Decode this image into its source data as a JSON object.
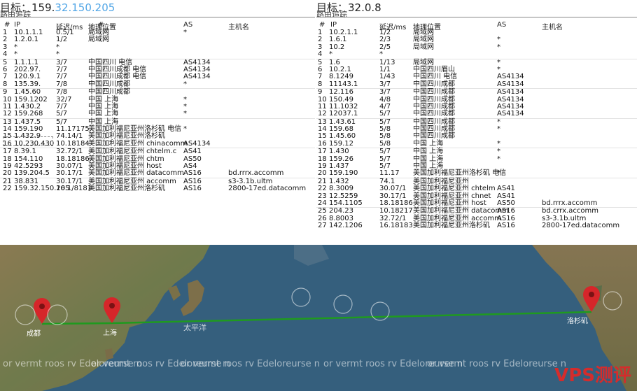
{
  "left": {
    "title_prefix": "目标：159.",
    "title_ip": "32.150.205",
    "subtitle": "路由追踪",
    "headers": [
      "#",
      "IP",
      "延迟/ms",
      "地理位置",
      "#",
      "AS",
      "主机名"
    ],
    "rows": [
      [
        "1",
        "10.1.1.1",
        "0.5/1",
        "局域网",
        "",
        "*",
        ""
      ],
      [
        "2",
        "1.2.0.1",
        "1/2",
        "局域网",
        "",
        "",
        ""
      ],
      [
        "3",
        "*",
        "*",
        "",
        "",
        "",
        ""
      ],
      [
        "4",
        "*",
        "*",
        "",
        "",
        "",
        ""
      ],
      [
        "5",
        "1.1.1.1",
        "3/7",
        "中国四川 电信",
        "",
        "AS4134",
        ""
      ],
      [
        "6",
        "202.97.",
        "7/7",
        "中国四川成都 电信",
        "",
        "AS4134",
        ""
      ],
      [
        "7",
        "120.9.1",
        "7/7",
        "中国四川成都 电信",
        "",
        "AS4134",
        ""
      ],
      [
        "8",
        "135.39.",
        "7/8",
        "中国四川成都",
        "",
        "*",
        ""
      ],
      [
        "9",
        "1.45.60",
        "7/8",
        "中国四川成都",
        "",
        "",
        ""
      ],
      [
        "10",
        "159.1202",
        "32/7",
        "中国 上海",
        "",
        "*",
        ""
      ],
      [
        "11",
        "1.430.2",
        "7/7",
        "中国 上海",
        "",
        "*",
        ""
      ],
      [
        "12",
        "159.268",
        "5/7",
        "中国 上海",
        "",
        "*",
        ""
      ],
      [
        "13",
        "1.437.5",
        "5/7",
        "中国 上海",
        "",
        "",
        ""
      ],
      [
        "14",
        "159.190",
        "11.17175",
        "美国加利福尼亚州洛杉矶 电信",
        "",
        "*",
        ""
      ],
      [
        "15",
        "1.432.9",
        "74.14/1",
        "美国加利福尼亚州洛杉矶",
        "",
        "",
        ""
      ],
      [
        "16",
        "10.230.430",
        "10.18184",
        "美国加利福尼亚州 chinacomm",
        "",
        "AS4134",
        ""
      ],
      [
        "17",
        "8.39.1",
        "32.72/1",
        "美国加利福尼亚州 chtelm.c",
        "",
        "AS41",
        ""
      ],
      [
        "18",
        "154.110",
        "18.18186",
        "美国加利福尼亚州 chtm",
        "",
        "AS50",
        ""
      ],
      [
        "19",
        "42.5293",
        "30.07/1",
        "美国加利福尼亚州 host",
        "",
        "AS4",
        ""
      ],
      [
        "20",
        "139.204.5",
        "30.17/1",
        "美国加利福尼亚州 datacomm",
        "",
        "AS16",
        "bd.rrrx.accomm"
      ],
      [
        "21",
        "38.831",
        "30.17/1",
        "美国加利福尼亚州 accomm",
        "",
        "AS16",
        "s3-3.1b.ultm"
      ],
      [
        "22",
        "159.32.150.205",
        "16.1/8181",
        "美国加利福尼亚州洛杉矶",
        "",
        "AS16",
        "2800-17ed.datacomm"
      ]
    ]
  },
  "right": {
    "title": "目标：32.0.8",
    "subtitle": "路由追踪",
    "headers": [
      "#",
      "IP",
      "延迟/ms",
      "地理位置",
      "AS",
      "主机名"
    ],
    "rows": [
      [
        "1",
        "10.2.1.1",
        "1/2",
        "局域网",
        "",
        ""
      ],
      [
        "2",
        "1.6.1",
        "2/3",
        "局域网",
        "*",
        ""
      ],
      [
        "3",
        "10.2",
        "2/5",
        "局域网",
        "*",
        ""
      ],
      [
        "4",
        "*",
        "*",
        "",
        "",
        ""
      ],
      [
        "5",
        "1.6",
        "1/13",
        "局域网",
        "*",
        ""
      ],
      [
        "6",
        "10.2.1",
        "1/1",
        "中国四川眉山",
        "*",
        ""
      ],
      [
        "7",
        "8.1249",
        "1/43",
        "中国四川 电信",
        "AS4134",
        ""
      ],
      [
        "8",
        "11143.1",
        "3/7",
        "中国四川成都",
        "AS4134",
        ""
      ],
      [
        "9",
        "12.116",
        "3/7",
        "中国四川成都",
        "AS4134",
        ""
      ],
      [
        "10",
        "150.49",
        "4/8",
        "中国四川成都",
        "AS4134",
        ""
      ],
      [
        "11",
        "11.1032",
        "4/7",
        "中国四川成都",
        "AS4134",
        ""
      ],
      [
        "12",
        "12037.1",
        "5/7",
        "中国四川成都",
        "AS4134",
        ""
      ],
      [
        "13",
        "1.43.61",
        "5/7",
        "中国四川成都",
        "*",
        ""
      ],
      [
        "14",
        "159.68",
        "5/8",
        "中国四川成都",
        "*",
        ""
      ],
      [
        "15",
        "1.45.60",
        "5/8",
        "中国四川成都",
        "",
        ""
      ],
      [
        "16",
        "159.12",
        "5/8",
        "中国 上海",
        "*",
        ""
      ],
      [
        "17",
        "1.430",
        "5/7",
        "中国 上海",
        "*",
        ""
      ],
      [
        "18",
        "159.26",
        "5/7",
        "中国 上海",
        "*",
        ""
      ],
      [
        "19",
        "1.437",
        "5/7",
        "中国 上海",
        "",
        ""
      ],
      [
        "20",
        "159.190",
        "11.17",
        "美国加利福尼亚州洛杉矶 电信",
        "*",
        ""
      ],
      [
        "21",
        "1.432",
        "74.1",
        "美国加利福尼亚州",
        "",
        ""
      ],
      [
        "22",
        "8.3009",
        "30.07/1",
        "美国加利福尼亚州 chtelm",
        "AS41",
        ""
      ],
      [
        "23",
        "12.5259",
        "30.17/1",
        "美国加利福尼亚州 chnet",
        "AS41",
        ""
      ],
      [
        "24",
        "154.1105",
        "18.18186",
        "美国加利福尼亚州 host",
        "AS50",
        "bd.rrrx.accomm"
      ],
      [
        "25",
        "204.23",
        "10.18217",
        "美国加利福尼亚州 datacomm",
        "AS16",
        "bd.crrx.accomm"
      ],
      [
        "26",
        "8.8003",
        "32.72/1",
        "美国加利福尼亚州 accomm",
        "AS16",
        "s3-3.1b.ultm"
      ],
      [
        "27",
        "142.1206",
        "16.18183",
        "美国加利福尼亚州洛杉矶",
        "AS16",
        "2800-17ed.datacomm"
      ]
    ]
  },
  "map": {
    "ocean_label": "太平洋",
    "watermark": "or vermt roos rv  Edeloreurse n",
    "brand": "VPS测评",
    "pins": [
      "成都",
      "上海",
      "洛杉矶"
    ],
    "route_color": "#1f9a1f",
    "pin_color": "#d6262a"
  }
}
